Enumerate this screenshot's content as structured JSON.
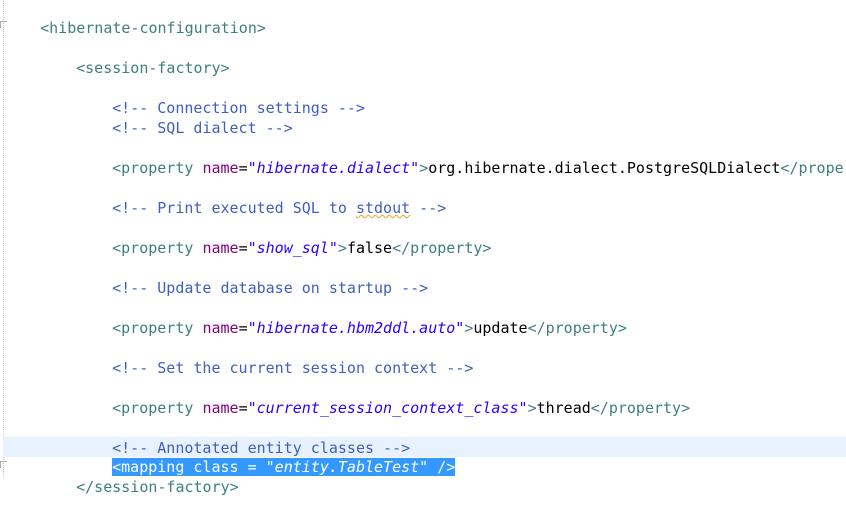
{
  "editor": {
    "lines": {
      "hibernate_open": "<hibernate-configuration>",
      "session_factory_open": "<session-factory>",
      "comment_connection": "<!-- Connection settings -->",
      "comment_dialect": "<!-- SQL dialect -->",
      "prop_dialect": {
        "open": "<property ",
        "attr": "name",
        "eq": "=",
        "value": "\"hibernate.dialect\"",
        "gt": ">",
        "text": "org.hibernate.dialect.PostgreSQLDialect",
        "close": "</property>"
      },
      "comment_print_before": "<!-- Print executed SQL to ",
      "comment_print_word": "stdout",
      "comment_print_after": " -->",
      "prop_show_sql": {
        "open": "<property ",
        "attr": "name",
        "eq": "=",
        "value": "\"show_sql\"",
        "gt": ">",
        "text": "false",
        "close": "</property>"
      },
      "comment_update": "<!-- Update database on startup -->",
      "prop_hbm2ddl": {
        "open": "<property ",
        "attr": "name",
        "eq": "=",
        "value": "\"hibernate.hbm2ddl.auto\"",
        "gt": ">",
        "text": "update",
        "close": "</property>"
      },
      "comment_session_context": "<!-- Set the current session context -->",
      "prop_session_context": {
        "open": "<property ",
        "attr": "name",
        "eq": "=",
        "value": "\"current_session_context_class\"",
        "gt": ">",
        "text": "thread",
        "close": "</property>"
      },
      "comment_annotated": "<!-- Annotated entity classes -->",
      "mapping": {
        "open": "<mapping ",
        "attr": "class",
        "eq": " = ",
        "value": "\"entity.TableTest\"",
        "close": " />"
      },
      "session_factory_close": "</session-factory>"
    }
  },
  "colors": {
    "tag": "#3f7f7f",
    "attribute": "#7f007f",
    "string": "#2a00ff",
    "comment": "#3f5fbf",
    "selection": "#3399ff",
    "current_line": "#e8f2fe"
  }
}
